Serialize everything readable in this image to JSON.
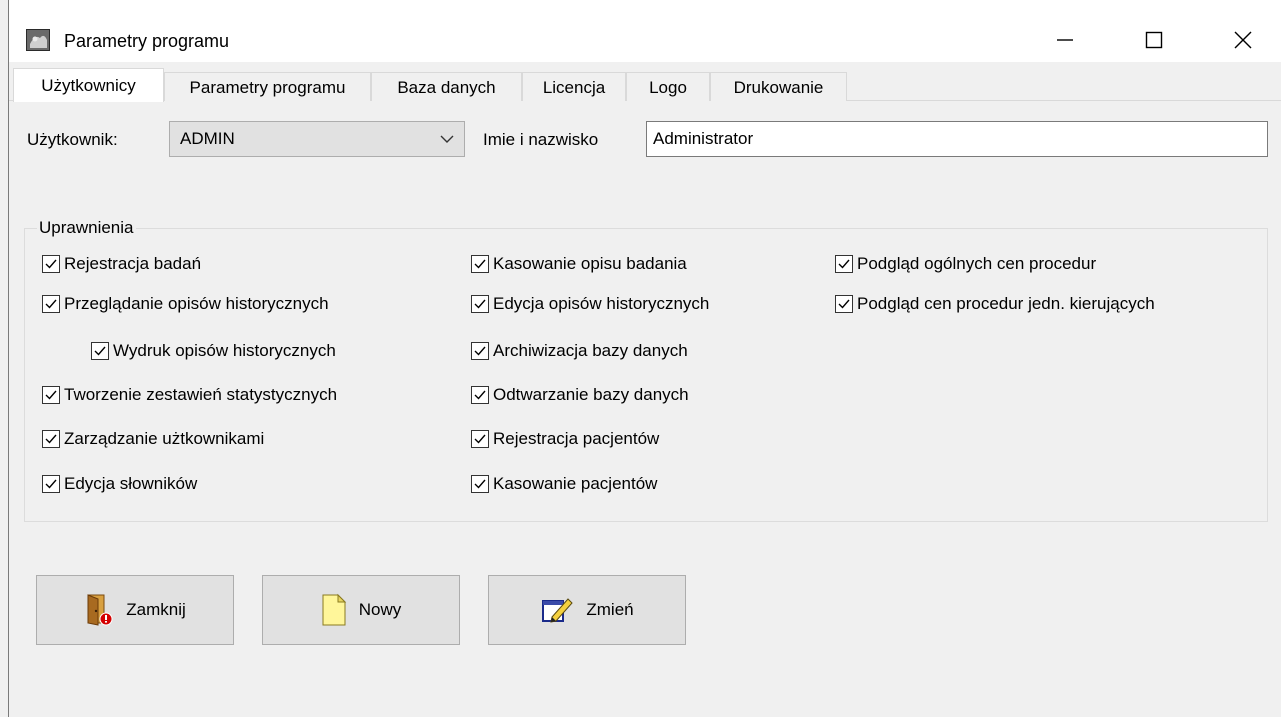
{
  "window": {
    "title": "Parametry programu"
  },
  "tabs": [
    {
      "label": "Użytkownicy",
      "active": true
    },
    {
      "label": "Parametry programu"
    },
    {
      "label": "Baza danych"
    },
    {
      "label": "Licencja"
    },
    {
      "label": "Logo"
    },
    {
      "label": "Drukowanie"
    }
  ],
  "user": {
    "user_label": "Użytkownik:",
    "user_value": "ADMIN",
    "name_label": "Imie i nazwisko",
    "name_value": "Administrator"
  },
  "permissions": {
    "legend": "Uprawnienia",
    "col1": [
      {
        "label": "Rejestracja badań",
        "checked": true
      },
      {
        "label": "Przeglądanie opisów historycznych",
        "checked": true
      },
      {
        "label": "Wydruk opisów historycznych",
        "checked": true
      },
      {
        "label": "Tworzenie zestawień statystycznych",
        "checked": true
      },
      {
        "label": "Zarządzanie użtkownikami",
        "checked": true
      },
      {
        "label": "Edycja słowników",
        "checked": true
      }
    ],
    "col2": [
      {
        "label": "Kasowanie opisu badania",
        "checked": true
      },
      {
        "label": "Edycja opisów historycznych",
        "checked": true
      },
      {
        "label": "Archiwizacja bazy danych",
        "checked": true
      },
      {
        "label": "Odtwarzanie bazy danych",
        "checked": true
      },
      {
        "label": "Rejestracja pacjentów",
        "checked": true
      },
      {
        "label": "Kasowanie pacjentów",
        "checked": true
      }
    ],
    "col3": [
      {
        "label": "Podgląd ogólnych cen procedur",
        "checked": true
      },
      {
        "label": "Podgląd cen procedur jedn. kierujących",
        "checked": true
      }
    ]
  },
  "buttons": {
    "close": "Zamknij",
    "new": "Nowy",
    "change": "Zmień"
  },
  "icons": {
    "app": "app-icon",
    "minimize": "minimize-icon",
    "maximize": "maximize-icon",
    "close": "close-icon",
    "dropdown": "chevron-down-icon",
    "door": "door-exit-icon",
    "document": "new-document-icon",
    "edit": "edit-pencil-icon"
  }
}
